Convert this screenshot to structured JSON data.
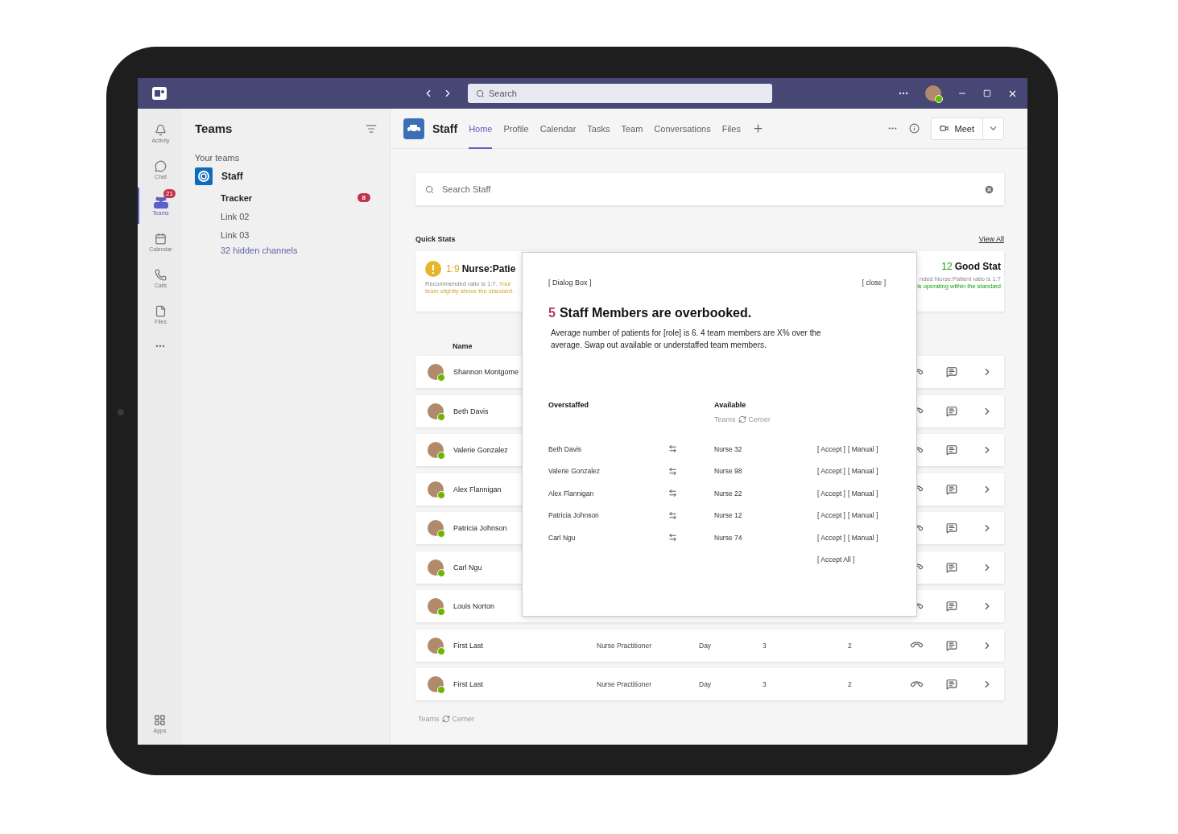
{
  "titlebar": {
    "search_placeholder": "Search"
  },
  "rail": [
    {
      "label": "Activity",
      "kind": "bell",
      "selected": false
    },
    {
      "label": "Chat",
      "kind": "chat",
      "selected": false
    },
    {
      "label": "Teams",
      "kind": "teams",
      "selected": true,
      "badge": "21"
    },
    {
      "label": "Calendar",
      "kind": "calendar",
      "selected": false
    },
    {
      "label": "Calls",
      "kind": "calls",
      "selected": false
    },
    {
      "label": "Files",
      "kind": "files",
      "selected": false
    }
  ],
  "rail_bottom": {
    "label": "Apps"
  },
  "teams_panel": {
    "title": "Teams",
    "section": "Your teams",
    "team": "Staff",
    "channels": [
      {
        "label": "Tracker",
        "bold": true,
        "badge": "8"
      },
      {
        "label": "Link 02",
        "bold": false
      },
      {
        "label": "Link 03",
        "bold": false
      }
    ],
    "hidden_channels": "32 hidden channels"
  },
  "header": {
    "team": "Staff",
    "tabs": [
      {
        "label": "Home",
        "selected": true
      },
      {
        "label": "Profile",
        "selected": false
      },
      {
        "label": "Calendar",
        "selected": false
      },
      {
        "label": "Tasks",
        "selected": false
      },
      {
        "label": "Team",
        "selected": false
      },
      {
        "label": "Conversations",
        "selected": false
      },
      {
        "label": "Files",
        "selected": false
      }
    ],
    "meet": "Meet"
  },
  "search": {
    "placeholder": "Search Staff"
  },
  "quick_stats": {
    "title": "Quick Stats",
    "view_all": "View All",
    "cards": [
      {
        "kind": "warning",
        "value": "1:9",
        "title": "Nurse:Patie",
        "note": "Recommended ratio is 1:7.",
        "status": "Your team slightly above the standard."
      },
      {
        "kind": "good",
        "value": "12",
        "title": "Good Stat",
        "note": "nded Nurse:Patient ratio is 1:7",
        "status": "is operating within the standard"
      }
    ]
  },
  "staff_table": {
    "columns": [
      "Name"
    ],
    "rows": [
      {
        "name": "Shannon Montgome"
      },
      {
        "name": "Beth Davis"
      },
      {
        "name": "Valerie Gonzalez"
      },
      {
        "name": "Alex Flannigan"
      },
      {
        "name": "Patricia Johnson"
      },
      {
        "name": "Carl Ngu"
      },
      {
        "name": "Louis Norton"
      },
      {
        "name": "First Last",
        "cells": [
          "Nurse Practitioner",
          "Day",
          "3",
          "2"
        ]
      },
      {
        "name": "First Last",
        "cells": [
          "Nurse Practitioner",
          "Day",
          "3",
          "2"
        ]
      }
    ]
  },
  "footer": {
    "from": "Teams",
    "to": "Cerner"
  },
  "dialog": {
    "label": "[ Dialog Box ]",
    "close": "[ close ]",
    "count": "5",
    "title": "Staff Members are overbooked.",
    "body": "Average number of patients for [role] is 6. 4 team members are X% over the average. Swap out available or understaffed team members.",
    "columns": [
      "Overstaffed",
      "Available"
    ],
    "source": {
      "from": "Teams",
      "to": "Cerner"
    },
    "swaps": [
      {
        "name": "Beth Davis",
        "replacement": "Nurse 32",
        "actions": [
          "[ Accept ]",
          "[ Manual ]"
        ]
      },
      {
        "name": "Valerie Gonzalez",
        "replacement": "Nurse 98",
        "actions": [
          "[ Accept ]",
          "[ Manual ]"
        ]
      },
      {
        "name": "Alex Flannigan",
        "replacement": "Nurse 22",
        "actions": [
          "[ Accept ]",
          "[ Manual ]"
        ]
      },
      {
        "name": "Patricia Johnson",
        "replacement": "Nurse 12",
        "actions": [
          "[ Accept ]",
          "[ Manual ]"
        ]
      },
      {
        "name": "Carl Ngu",
        "replacement": "Nurse 74",
        "actions": [
          "[ Accept ]",
          "[ Manual ]"
        ]
      }
    ],
    "accept_all": "[ Accept All ]"
  }
}
